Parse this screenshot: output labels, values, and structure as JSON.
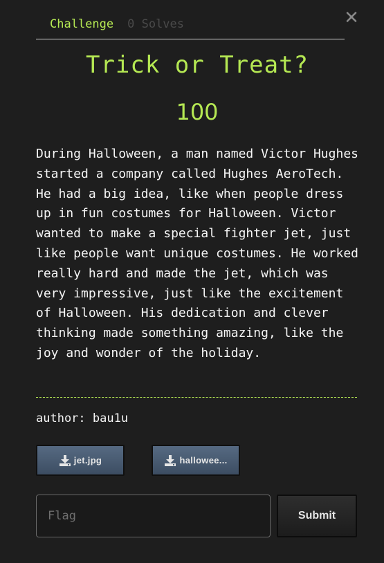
{
  "tabs": {
    "active": "Challenge",
    "inactive": "0 Solves"
  },
  "close": {
    "glyph": "✕",
    "icon": "close-icon"
  },
  "challenge": {
    "title": "Trick or Treat?",
    "points": "100",
    "description": "During Halloween, a man named Victor Hughes started a company called Hughes AeroTech. He had a big idea, like when people dress up in fun costumes for Halloween. Victor wanted to make a special fighter jet, just like people want unique costumes. He worked really hard and made the jet, which was very impressive, just like the excitement of Halloween. His dedication and clever thinking made something amazing, like the joy and wonder of the holiday.",
    "author": "author: bau1u"
  },
  "files": [
    {
      "label": "jet.jpg",
      "icon": "download-icon"
    },
    {
      "label": "hallowee...",
      "icon": "download-icon"
    }
  ],
  "flag": {
    "placeholder": "Flag",
    "value": ""
  },
  "submit": {
    "label": "Submit"
  },
  "colors": {
    "background": "#1e1e1e",
    "accent": "#b5e853",
    "text": "#f5f5f5",
    "file_button": "#4a5c73"
  }
}
